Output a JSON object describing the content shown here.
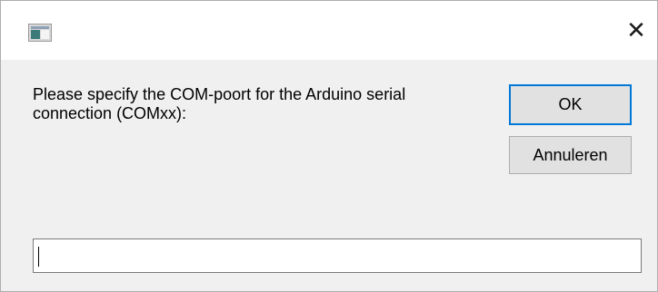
{
  "dialog": {
    "close_glyph": "✕",
    "message": "Please specify the COM-poort for the Arduino serial\nconnection (COMxx):",
    "ok_label": "OK",
    "cancel_label": "Annuleren",
    "input_value": "",
    "icons": {
      "app": "app-window-icon",
      "close": "close-icon"
    },
    "colors": {
      "default_button_border": "#0078d7",
      "dialog_background": "#f0f0f0"
    }
  }
}
